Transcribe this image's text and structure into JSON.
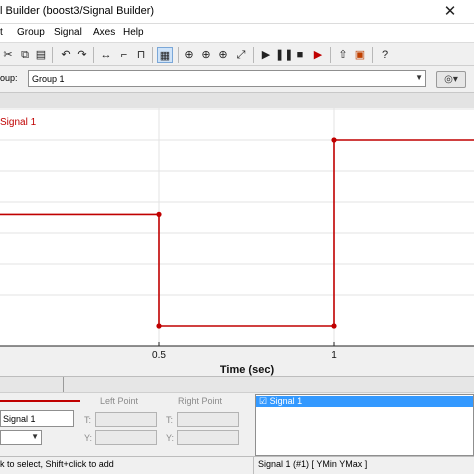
{
  "window": {
    "title": "l Builder (boost3/Signal Builder)",
    "close_glyph": "✕"
  },
  "menu": [
    "t",
    "Group",
    "Signal",
    "Axes",
    "Help"
  ],
  "toolbar": {
    "icons": [
      "cut-icon",
      "undo-icon",
      "redo-icon",
      "line-icon",
      "step-up-icon",
      "step-down-icon",
      "pulse-icon",
      "grid-icon",
      "zoom-x-icon",
      "zoom-y-icon",
      "zoom-icon",
      "full-view-icon",
      "play-icon",
      "pause-icon",
      "stop-icon",
      "run-all-icon",
      "up-arrow-icon",
      "model-icon",
      "help-icon"
    ]
  },
  "group": {
    "label": "oup:",
    "value": "Group 1",
    "options_glyph": "◎▾"
  },
  "plot": {
    "signal_label": "Signal 1",
    "xlabel": "Time (sec)",
    "line_color": "#c00000"
  },
  "chart_data": {
    "type": "line",
    "x": [
      0,
      0.5,
      0.5,
      1,
      1,
      1.5
    ],
    "y": [
      0.6,
      0.6,
      0,
      0,
      1,
      1
    ],
    "xticks": [
      "0.5",
      "1"
    ],
    "xlabel": "Time (sec)",
    "series": [
      {
        "name": "Signal 1",
        "color": "#c00000",
        "points": [
          [
            0,
            0.6
          ],
          [
            0.5,
            0.6
          ],
          [
            0.5,
            0
          ],
          [
            1,
            0
          ],
          [
            1,
            1
          ],
          [
            1.5,
            1
          ]
        ]
      }
    ]
  },
  "bottom": {
    "left_point_label": "Left Point",
    "right_point_label": "Right Point",
    "signal_name": "Signal 1",
    "t_label": "T:",
    "y_label": "Y:",
    "signal_list": [
      "Signal 1"
    ]
  },
  "status": {
    "left": "k to select, Shift+click to add",
    "right": "Signal 1 (#1)  [ YMin YMax ]"
  }
}
